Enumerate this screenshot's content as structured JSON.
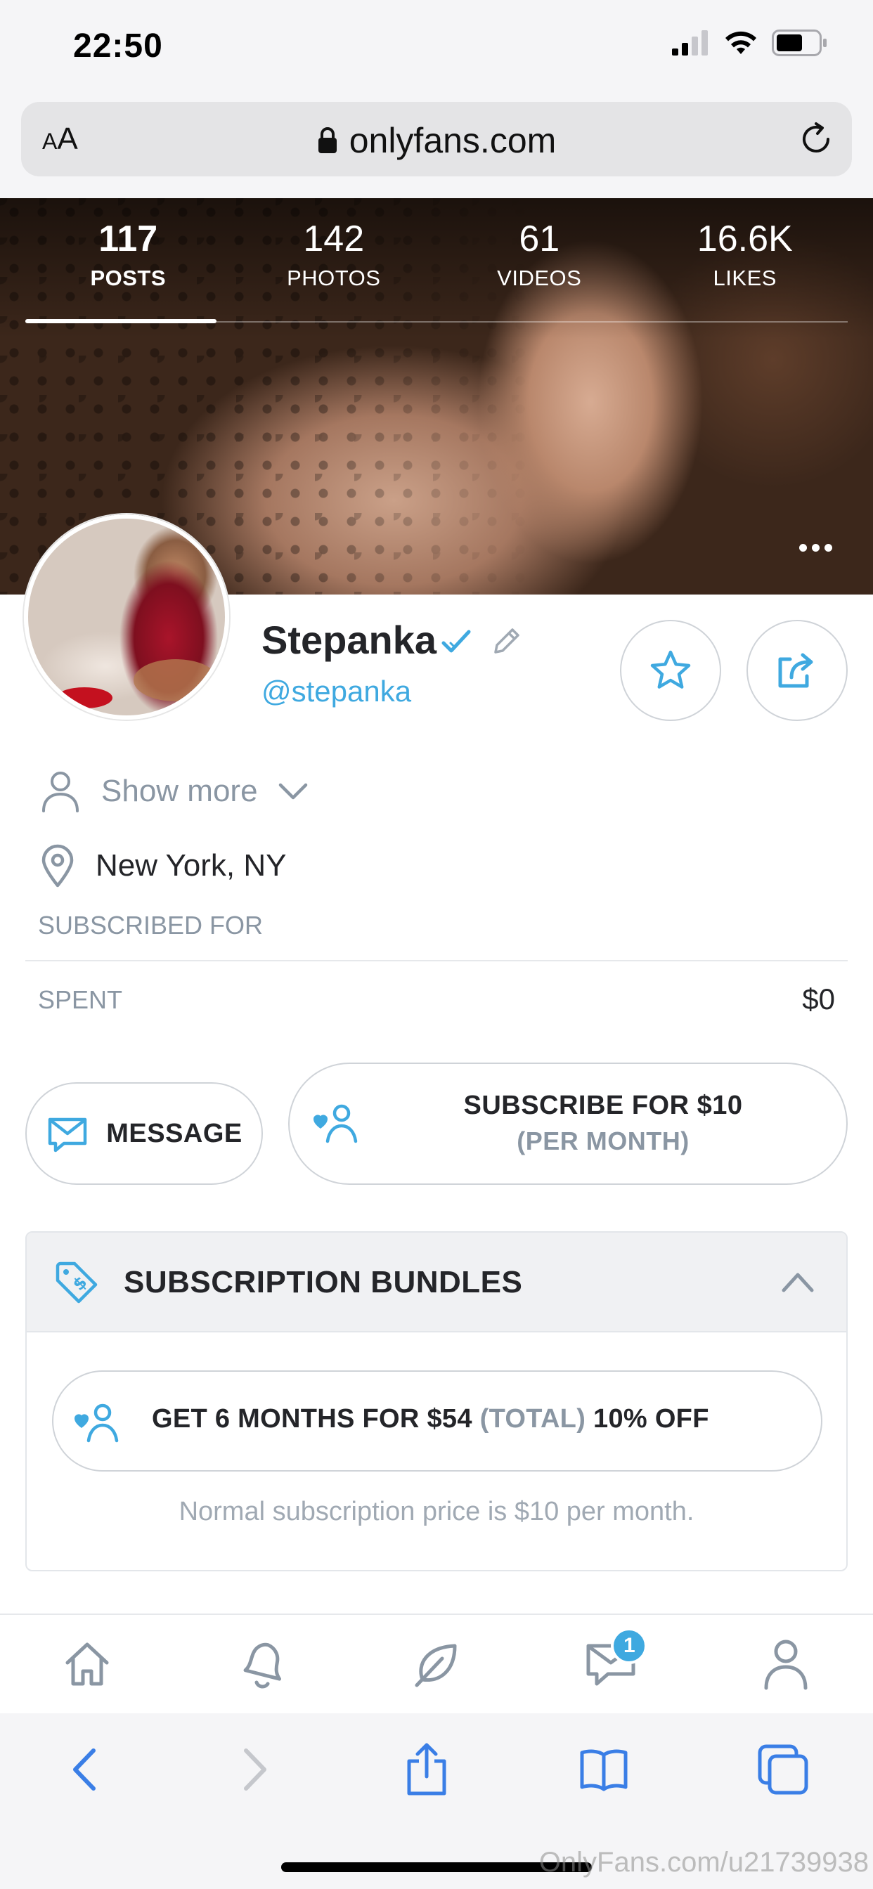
{
  "status_bar": {
    "time": "22:50"
  },
  "browser": {
    "text_size_label_small": "A",
    "text_size_label_large": "A",
    "url": "onlyfans.com"
  },
  "profile_stats": [
    {
      "value": "117",
      "label": "POSTS",
      "active": true
    },
    {
      "value": "142",
      "label": "PHOTOS",
      "active": false
    },
    {
      "value": "61",
      "label": "VIDEOS",
      "active": false
    },
    {
      "value": "16.6K",
      "label": "LIKES",
      "active": false
    }
  ],
  "profile": {
    "name": "Stepanka",
    "handle": "@stepanka",
    "show_more_label": "Show more",
    "location": "New York, NY",
    "subscribed_for_label": "SUBSCRIBED FOR",
    "spent_label": "SPENT",
    "spent_value": "$0"
  },
  "actions": {
    "message_label": "MESSAGE",
    "subscribe_label": "SUBSCRIBE FOR $10",
    "subscribe_sub_label": "(PER MONTH)"
  },
  "bundles": {
    "title": "SUBSCRIPTION BUNDLES",
    "offer_main": "GET 6 MONTHS FOR $54",
    "offer_total": "(TOTAL)",
    "offer_discount": "10% OFF",
    "note": "Normal subscription price is $10 per month."
  },
  "tab_bar": {
    "items": [
      "home-icon",
      "bell-icon",
      "leaf-icon",
      "messages-icon",
      "profile-icon"
    ],
    "messages_badge": "1"
  },
  "watermark": "OnlyFans.com/u21739938",
  "colors": {
    "accent": "#3fa9e0",
    "muted": "#8a96a3",
    "text": "#242529"
  }
}
